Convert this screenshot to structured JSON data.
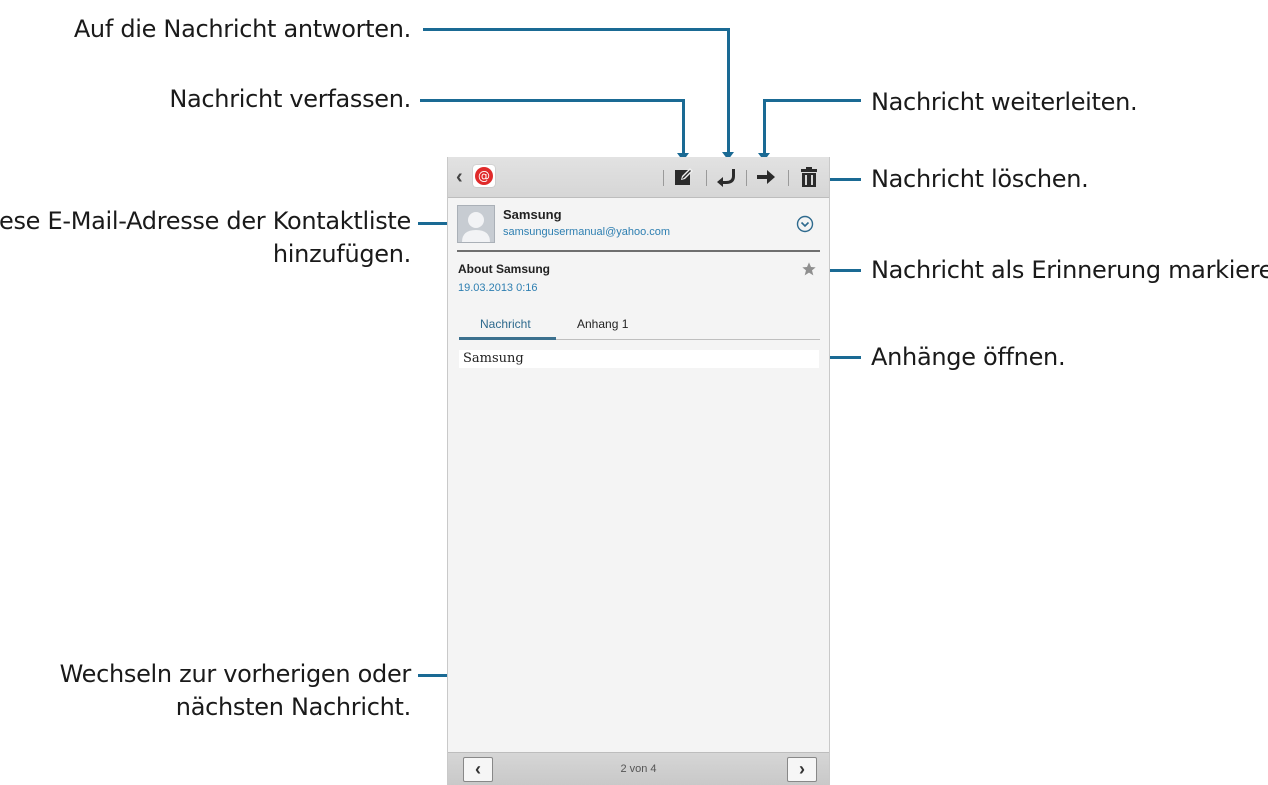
{
  "callouts": {
    "reply": "Auf die Nachricht antworten.",
    "compose": "Nachricht verfassen.",
    "forward": "Nachricht weiterleiten.",
    "delete": "Nachricht löschen.",
    "add_contact_line1": "Diese E-Mail-Adresse der Kontaktliste",
    "add_contact_line2": "hinzufügen.",
    "star": "Nachricht als Erinnerung markieren.",
    "attachments": "Anhänge öffnen.",
    "navigate_line1": "Wechseln zur vorherigen oder",
    "navigate_line2": "nächsten Nachricht."
  },
  "toolbar": {
    "back_icon": "chevron-left-icon",
    "app_icon": "email-app-icon",
    "actions": [
      "compose-icon",
      "reply-icon",
      "forward-icon",
      "delete-icon"
    ]
  },
  "message": {
    "sender_name": "Samsung",
    "sender_email": "samsungusermanual@yahoo.com",
    "subject": "About Samsung",
    "date": "19.03.2013  0:16",
    "tabs": [
      "Nachricht",
      "Anhang 1"
    ],
    "body": "Samsung"
  },
  "footer": {
    "prev_label": "‹",
    "next_label": "›",
    "page_counter": "2 von 4"
  },
  "colors": {
    "callout_line": "#1a6a94",
    "link_blue": "#2e7fb1",
    "tab_active": "#3b708e"
  }
}
